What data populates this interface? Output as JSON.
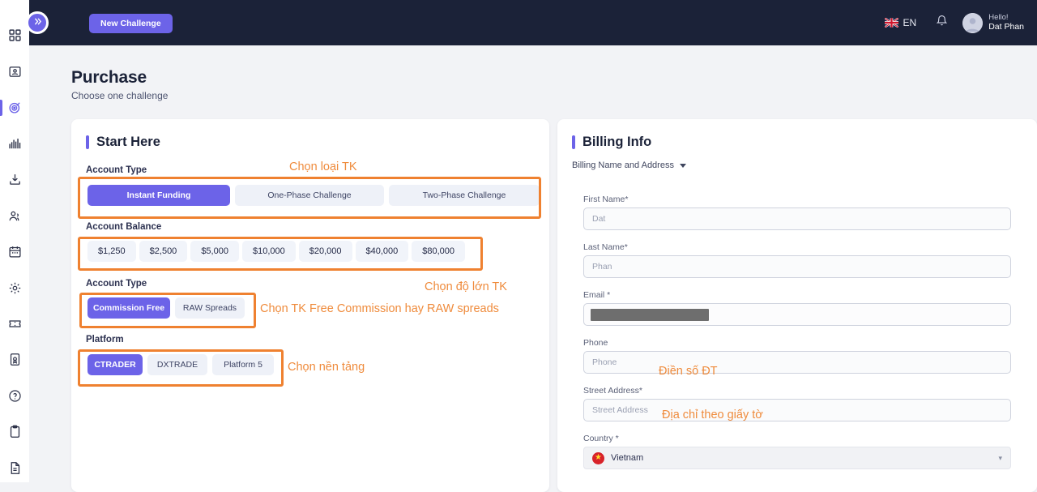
{
  "nav": {
    "new_challenge_label": "New Challenge",
    "language": "EN",
    "greeting": "Hello!",
    "user_name": "Dat Phan",
    "collapse_label": "»"
  },
  "sidebar": {
    "items": [
      {
        "name": "dashboard",
        "icon": "grid-icon",
        "active": false
      },
      {
        "name": "account",
        "icon": "id-card-icon",
        "active": false
      },
      {
        "name": "challenges",
        "icon": "target-icon",
        "active": true
      },
      {
        "name": "statistics",
        "icon": "bar-chart-icon",
        "active": false
      },
      {
        "name": "withdraw",
        "icon": "download-icon",
        "active": false
      },
      {
        "name": "affiliates",
        "icon": "users-icon",
        "active": false
      },
      {
        "name": "calendar",
        "icon": "calendar-icon",
        "active": false
      },
      {
        "name": "settings",
        "icon": "gear-icon",
        "active": false
      },
      {
        "name": "coupons",
        "icon": "ticket-icon",
        "active": false
      },
      {
        "name": "certificates",
        "icon": "certificate-icon",
        "active": false
      },
      {
        "name": "help",
        "icon": "question-circle-icon",
        "active": false
      },
      {
        "name": "clipboard",
        "icon": "clipboard-icon",
        "active": false
      },
      {
        "name": "documents",
        "icon": "document-icon",
        "active": false
      }
    ]
  },
  "page": {
    "title": "Purchase",
    "subtitle": "Choose one challenge"
  },
  "start_here": {
    "title": "Start Here",
    "account_type_label": "Account Type",
    "account_types": [
      {
        "label": "Instant Funding",
        "selected": true
      },
      {
        "label": "One-Phase Challenge",
        "selected": false
      },
      {
        "label": "Two-Phase Challenge",
        "selected": false
      }
    ],
    "account_balance_label": "Account Balance",
    "balances": [
      {
        "label": "$1,250",
        "selected": false
      },
      {
        "label": "$2,500",
        "selected": false
      },
      {
        "label": "$5,000",
        "selected": false
      },
      {
        "label": "$10,000",
        "selected": false
      },
      {
        "label": "$20,000",
        "selected": false
      },
      {
        "label": "$40,000",
        "selected": false
      },
      {
        "label": "$80,000",
        "selected": false
      }
    ],
    "commission_label": "Account Type",
    "commission_types": [
      {
        "label": "Commission Free",
        "selected": true
      },
      {
        "label": "RAW Spreads",
        "selected": false
      }
    ],
    "platform_label": "Platform",
    "platforms": [
      {
        "label": "CTRADER",
        "selected": true
      },
      {
        "label": "DXTRADE",
        "selected": false
      },
      {
        "label": "Platform 5",
        "selected": false
      }
    ]
  },
  "billing": {
    "title": "Billing Info",
    "section_select": "Billing Name and Address",
    "fields": [
      {
        "label": "First Name*",
        "placeholder": "Dat",
        "value": ""
      },
      {
        "label": "Last Name*",
        "placeholder": "Phan",
        "value": ""
      },
      {
        "label": "Email *",
        "placeholder": "",
        "value": "",
        "redacted": true
      },
      {
        "label": "Phone",
        "placeholder": "Phone",
        "value": ""
      },
      {
        "label": "Street Address*",
        "placeholder": "Street Address",
        "value": ""
      }
    ],
    "country_label": "Country *",
    "country_value": "Vietnam"
  },
  "annotations": [
    {
      "id": "a1",
      "text": "Chọn loại TK"
    },
    {
      "id": "a2",
      "text": "Chọn độ lớn TK"
    },
    {
      "id": "a3",
      "text": "Chọn TK Free Commission hay RAW spreads"
    },
    {
      "id": "a4",
      "text": "Chọn nền tảng"
    },
    {
      "id": "a5",
      "text": "Điền số ĐT"
    },
    {
      "id": "a6",
      "text": "Địa chỉ theo giấy tờ"
    }
  ],
  "colors": {
    "accent_purple": "#6c63e8",
    "nav_dark": "#1b2238",
    "annotation_orange": "#ef8130",
    "page_bg": "#f2f3f6"
  }
}
